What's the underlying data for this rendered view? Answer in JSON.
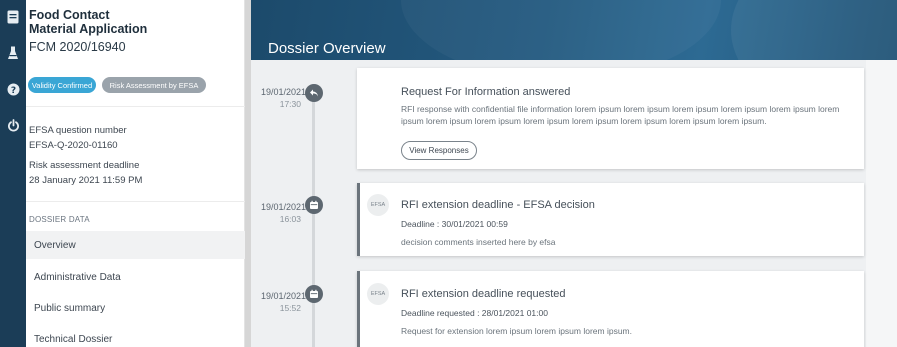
{
  "rail": {
    "icons": [
      "document-icon",
      "flask-icon",
      "help-icon",
      "power-icon"
    ]
  },
  "application": {
    "title_line1": "Food Contact",
    "title_line2": "Material Application",
    "id": "FCM 2020/16940"
  },
  "badges": {
    "validity": "Validity Confirmed",
    "risk": "Risk Assessment by EFSA"
  },
  "meta": {
    "question_label": "EFSA question number",
    "question_value": "EFSA-Q-2020-01160",
    "deadline_label": "Risk assessment deadline",
    "deadline_value": "28 January 2021 11:59 PM"
  },
  "dossier": {
    "section_title": "DOSSIER DATA",
    "items": [
      "Overview",
      "Administrative Data",
      "Public summary",
      "Technical Dossier"
    ]
  },
  "page": {
    "title": "Dossier Overview"
  },
  "timeline": [
    {
      "date": "19/01/2021",
      "time": "17:30",
      "icon": "reply-icon",
      "title": "Request For Information answered",
      "text": "RFI response with confidential file information lorem ipsum lorem ipsum lorem ipsum lorem ipsum lorem ipsum lorem ipsum lorem ipsum lorem ipsum lorem ipsum lorem ipsum lorem ipsum lorem ipsum lorem ipsum.",
      "button": "View Responses"
    },
    {
      "date": "19/01/2021",
      "time": "16:03",
      "icon": "calendar-icon",
      "avatar": "EFSA",
      "title": "RFI extension deadline - EFSA decision",
      "detail": "Deadline : 30/01/2021 00:59",
      "text": "decision comments inserted here by efsa"
    },
    {
      "date": "19/01/2021",
      "time": "15:52",
      "icon": "calendar-icon",
      "avatar": "EFSA",
      "title": "RFI extension deadline requested",
      "detail": "Deadline requested : 28/01/2021 01:00",
      "text": "Request for extension lorem ipsum lorem ipsum lorem ipsum."
    }
  ]
}
